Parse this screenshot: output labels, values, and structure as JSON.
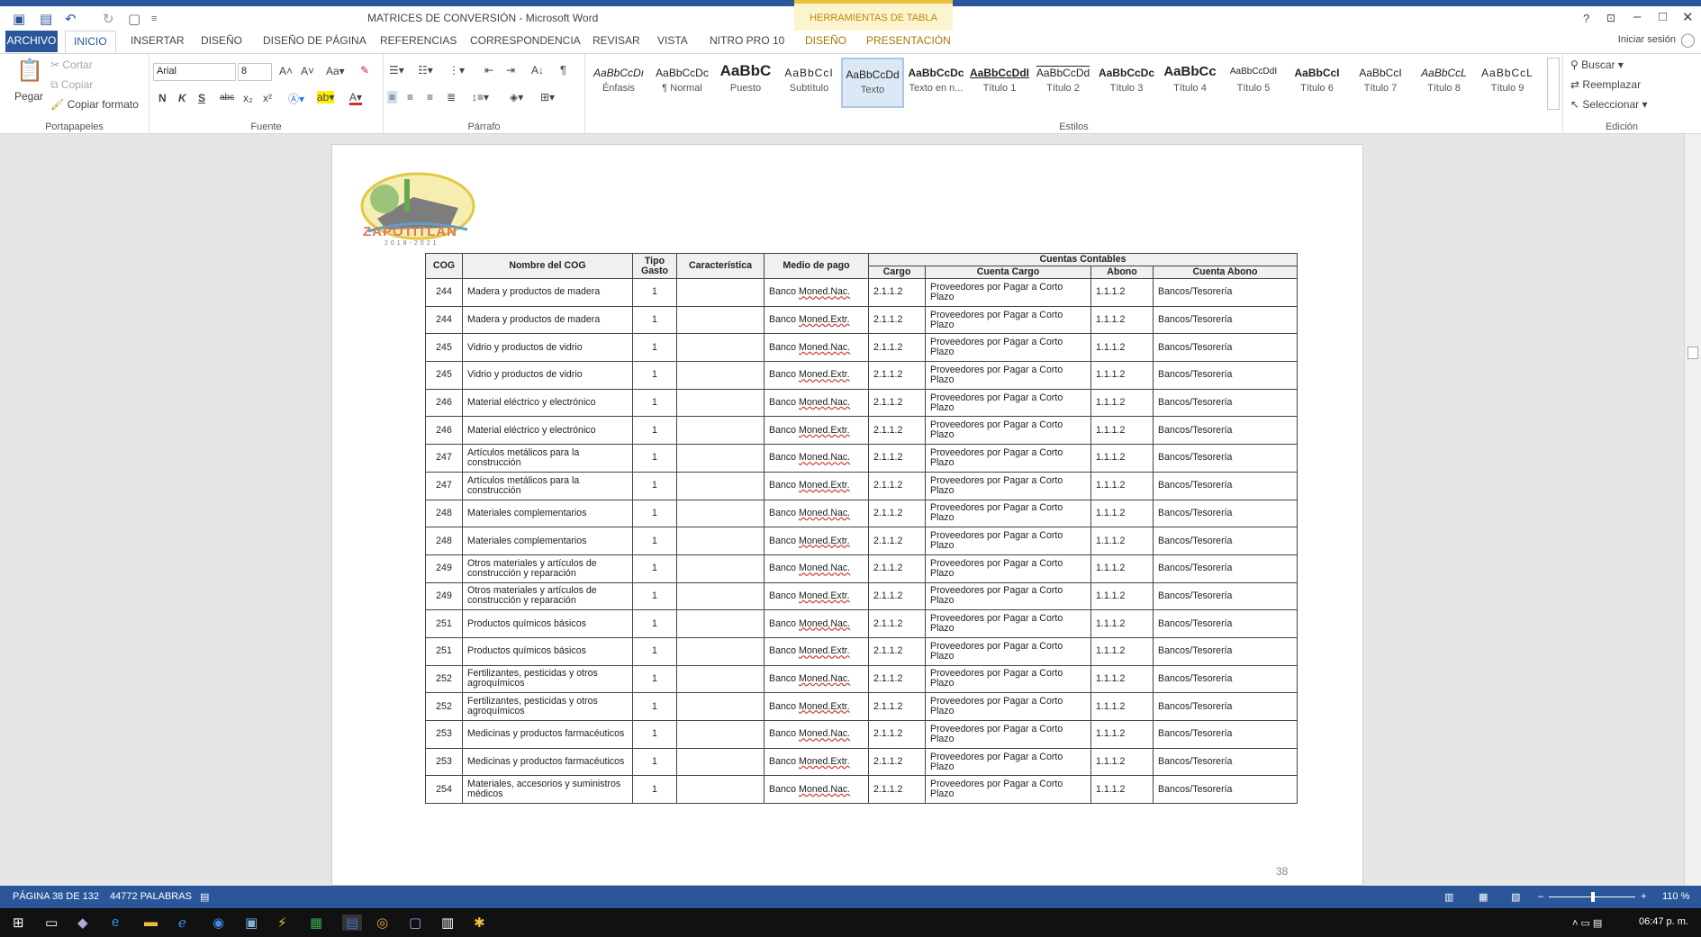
{
  "window": {
    "title": "MATRICES DE CONVERSIÓN - Microsoft Word",
    "contextual_tab_group": "HERRAMIENTAS DE TABLA",
    "help": "?",
    "minimize": "–",
    "maximize": "□",
    "close": "✕",
    "login": "Iniciar sesión"
  },
  "tabs": [
    "ARCHIVO",
    "INICIO",
    "INSERTAR",
    "DISEÑO",
    "DISEÑO DE PÁGINA",
    "REFERENCIAS",
    "CORRESPONDENCIA",
    "REVISAR",
    "VISTA",
    "NITRO PRO 10",
    "DISEÑO",
    "PRESENTACIÓN"
  ],
  "clipboard": {
    "paste": "Pegar",
    "cut": "Cortar",
    "copy": "Copiar",
    "format_painter": "Copiar formato",
    "label": "Portapapeles"
  },
  "font": {
    "name": "Arial",
    "size": "8",
    "bold": "N",
    "italic": "K",
    "underline": "S",
    "strike": "abc",
    "sub": "x₂",
    "sup": "x²",
    "label": "Fuente"
  },
  "paragraph": {
    "label": "Párrafo"
  },
  "styles": {
    "label": "Estilos",
    "items": [
      {
        "preview": "AaBbCcDı",
        "name": "Énfasis"
      },
      {
        "preview": "AaBbCcDc",
        "name": "¶ Normal"
      },
      {
        "preview": "AaBbC",
        "name": "Puesto"
      },
      {
        "preview": "AaBbCcI",
        "name": "Subtítulo"
      },
      {
        "preview": "AaBbCcDd",
        "name": "Texto"
      },
      {
        "preview": "AaBbCcDc",
        "name": "Texto en n..."
      },
      {
        "preview": "AaBbCcDdI",
        "name": "Título 1"
      },
      {
        "preview": "AaBbCcDd",
        "name": "Título 2"
      },
      {
        "preview": "AaBbCcDc",
        "name": "Título 3"
      },
      {
        "preview": "AaBbCc",
        "name": "Título 4"
      },
      {
        "preview": "AaBbCcDdI",
        "name": "Título 5"
      },
      {
        "preview": "AaBbCcI",
        "name": "Título 6"
      },
      {
        "preview": "AaBbCcI",
        "name": "Título 7"
      },
      {
        "preview": "AaBbCcL",
        "name": "Título 8"
      },
      {
        "preview": "AaBbCcL",
        "name": "Título 9"
      }
    ]
  },
  "editing": {
    "find": "Buscar",
    "replace": "Reemplazar",
    "select": "Seleccionar",
    "label": "Edición"
  },
  "document": {
    "logo_text": "ZAPOTITLÁN",
    "logo_years": "2018-2021",
    "page_number": "38",
    "headers": {
      "cog": "COG",
      "nombre": "Nombre del COG",
      "tipo": "Tipo Gasto",
      "caracteristica": "Característica",
      "medio": "Medio de pago",
      "cuentas": "Cuentas Contables",
      "cargo": "Cargo",
      "cuenta_cargo": "Cuenta Cargo",
      "abono": "Abono",
      "cuenta_abono": "Cuenta Abono"
    },
    "rows": [
      {
        "cog": "244",
        "nombre": "Madera y productos de madera",
        "tipo": "1",
        "car": "",
        "banco": "Banco",
        "moned": "Moned.Nac.",
        "cargo": "2.1.1.2",
        "cuenta_cargo": "Proveedores por Pagar a Corto Plazo",
        "abono": "1.1.1.2",
        "cuenta_abono": "Bancos/Tesorería"
      },
      {
        "cog": "244",
        "nombre": "Madera y productos de madera",
        "tipo": "1",
        "car": "",
        "banco": "Banco",
        "moned": "Moned.Extr.",
        "cargo": "2.1.1.2",
        "cuenta_cargo": "Proveedores por Pagar a Corto Plazo",
        "abono": "1.1.1.2",
        "cuenta_abono": "Bancos/Tesorería"
      },
      {
        "cog": "245",
        "nombre": "Vidrio y productos de vidrio",
        "tipo": "1",
        "car": "",
        "banco": "Banco",
        "moned": "Moned.Nac.",
        "cargo": "2.1.1.2",
        "cuenta_cargo": "Proveedores por Pagar a Corto Plazo",
        "abono": "1.1.1.2",
        "cuenta_abono": "Bancos/Tesorería"
      },
      {
        "cog": "245",
        "nombre": "Vidrio y productos de vidrio",
        "tipo": "1",
        "car": "",
        "banco": "Banco",
        "moned": "Moned.Extr.",
        "cargo": "2.1.1.2",
        "cuenta_cargo": "Proveedores por Pagar a Corto Plazo",
        "abono": "1.1.1.2",
        "cuenta_abono": "Bancos/Tesorería"
      },
      {
        "cog": "246",
        "nombre": "Material eléctrico y electrónico",
        "tipo": "1",
        "car": "",
        "banco": "Banco",
        "moned": "Moned.Nac.",
        "cargo": "2.1.1.2",
        "cuenta_cargo": "Proveedores por Pagar a Corto Plazo",
        "abono": "1.1.1.2",
        "cuenta_abono": "Bancos/Tesorería"
      },
      {
        "cog": "246",
        "nombre": "Material eléctrico y electrónico",
        "tipo": "1",
        "car": "",
        "banco": "Banco",
        "moned": "Moned.Extr.",
        "cargo": "2.1.1.2",
        "cuenta_cargo": "Proveedores por Pagar a Corto Plazo",
        "abono": "1.1.1.2",
        "cuenta_abono": "Bancos/Tesorería"
      },
      {
        "cog": "247",
        "nombre": "Artículos metálicos para la construcción",
        "tipo": "1",
        "car": "",
        "banco": "Banco",
        "moned": "Moned.Nac.",
        "cargo": "2.1.1.2",
        "cuenta_cargo": "Proveedores por Pagar a Corto Plazo",
        "abono": "1.1.1.2",
        "cuenta_abono": "Bancos/Tesorería"
      },
      {
        "cog": "247",
        "nombre": "Artículos metálicos para la construcción",
        "tipo": "1",
        "car": "",
        "banco": "Banco",
        "moned": "Moned.Extr.",
        "cargo": "2.1.1.2",
        "cuenta_cargo": "Proveedores por Pagar a Corto Plazo",
        "abono": "1.1.1.2",
        "cuenta_abono": "Bancos/Tesorería"
      },
      {
        "cog": "248",
        "nombre": "Materiales complementarios",
        "tipo": "1",
        "car": "",
        "banco": "Banco",
        "moned": "Moned.Nac.",
        "cargo": "2.1.1.2",
        "cuenta_cargo": "Proveedores por Pagar a Corto Plazo",
        "abono": "1.1.1.2",
        "cuenta_abono": "Bancos/Tesorería"
      },
      {
        "cog": "248",
        "nombre": "Materiales complementarios",
        "tipo": "1",
        "car": "",
        "banco": "Banco",
        "moned": "Moned.Extr.",
        "cargo": "2.1.1.2",
        "cuenta_cargo": "Proveedores por Pagar a Corto Plazo",
        "abono": "1.1.1.2",
        "cuenta_abono": "Bancos/Tesorería"
      },
      {
        "cog": "249",
        "nombre": "Otros materiales y artículos de construcción y reparación",
        "tipo": "1",
        "car": "",
        "banco": "Banco",
        "moned": "Moned.Nac.",
        "cargo": "2.1.1.2",
        "cuenta_cargo": "Proveedores por Pagar a Corto Plazo",
        "abono": "1.1.1.2",
        "cuenta_abono": "Bancos/Tesorería"
      },
      {
        "cog": "249",
        "nombre": "Otros materiales y artículos de construcción y reparación",
        "tipo": "1",
        "car": "",
        "banco": "Banco",
        "moned": "Moned.Extr.",
        "cargo": "2.1.1.2",
        "cuenta_cargo": "Proveedores por Pagar a Corto Plazo",
        "abono": "1.1.1.2",
        "cuenta_abono": "Bancos/Tesorería"
      },
      {
        "cog": "251",
        "nombre": "Productos químicos básicos",
        "tipo": "1",
        "car": "",
        "banco": "Banco",
        "moned": "Moned.Nac.",
        "cargo": "2.1.1.2",
        "cuenta_cargo": "Proveedores por Pagar a Corto Plazo",
        "abono": "1.1.1.2",
        "cuenta_abono": "Bancos/Tesorería"
      },
      {
        "cog": "251",
        "nombre": "Productos químicos básicos",
        "tipo": "1",
        "car": "",
        "banco": "Banco",
        "moned": "Moned.Extr.",
        "cargo": "2.1.1.2",
        "cuenta_cargo": "Proveedores por Pagar a Corto Plazo",
        "abono": "1.1.1.2",
        "cuenta_abono": "Bancos/Tesorería"
      },
      {
        "cog": "252",
        "nombre": "Fertilizantes, pesticidas y otros agroquímicos",
        "tipo": "1",
        "car": "",
        "banco": "Banco",
        "moned": "Moned.Nac.",
        "cargo": "2.1.1.2",
        "cuenta_cargo": "Proveedores por Pagar a Corto Plazo",
        "abono": "1.1.1.2",
        "cuenta_abono": "Bancos/Tesorería"
      },
      {
        "cog": "252",
        "nombre": "Fertilizantes, pesticidas y otros agroquímicos",
        "tipo": "1",
        "car": "",
        "banco": "Banco",
        "moned": "Moned.Extr.",
        "cargo": "2.1.1.2",
        "cuenta_cargo": "Proveedores por Pagar a Corto Plazo",
        "abono": "1.1.1.2",
        "cuenta_abono": "Bancos/Tesorería"
      },
      {
        "cog": "253",
        "nombre": "Medicinas y productos farmacéuticos",
        "tipo": "1",
        "car": "",
        "banco": "Banco",
        "moned": "Moned.Nac.",
        "cargo": "2.1.1.2",
        "cuenta_cargo": "Proveedores por Pagar a Corto Plazo",
        "abono": "1.1.1.2",
        "cuenta_abono": "Bancos/Tesorería"
      },
      {
        "cog": "253",
        "nombre": "Medicinas y productos farmacéuticos",
        "tipo": "1",
        "car": "",
        "banco": "Banco",
        "moned": "Moned.Extr.",
        "cargo": "2.1.1.2",
        "cuenta_cargo": "Proveedores por Pagar a Corto Plazo",
        "abono": "1.1.1.2",
        "cuenta_abono": "Bancos/Tesorería"
      },
      {
        "cog": "254",
        "nombre": "Materiales, accesorios y suministros médicos",
        "tipo": "1",
        "car": "",
        "banco": "Banco",
        "moned": "Moned.Nac.",
        "cargo": "2.1.1.2",
        "cuenta_cargo": "Proveedores por Pagar a Corto Plazo",
        "abono": "1.1.1.2",
        "cuenta_abono": "Bancos/Tesorería"
      }
    ]
  },
  "status": {
    "page": "PÁGINA 38 DE 132",
    "words": "44772 PALABRAS",
    "zoom": "110 %"
  },
  "taskbar": {
    "time": "06:47 p. m."
  },
  "colors": {
    "word_blue": "#2b579a",
    "contextual_yellow": "#e8c03a",
    "spell_red": "#d0312d"
  }
}
